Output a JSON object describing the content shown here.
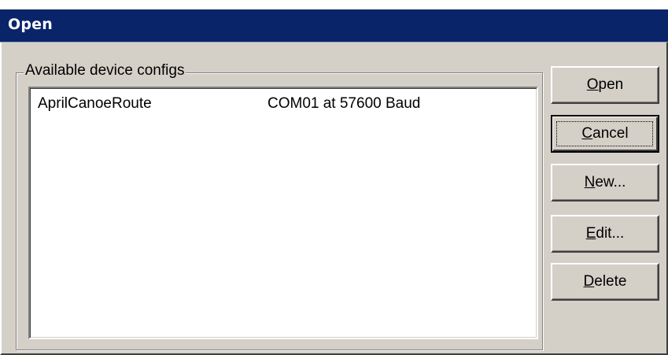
{
  "window": {
    "title": "Open"
  },
  "groupbox": {
    "label": "Available device configs"
  },
  "list": {
    "items": [
      {
        "name": "AprilCanoeRoute",
        "port": "COM01 at 57600 Baud"
      }
    ]
  },
  "buttons": {
    "open": {
      "mnemonic": "O",
      "rest": "pen"
    },
    "cancel": {
      "mnemonic": "C",
      "rest": "ancel"
    },
    "new": {
      "mnemonic": "N",
      "rest": "ew..."
    },
    "edit": {
      "mnemonic": "E",
      "rest": "dit..."
    },
    "delete": {
      "mnemonic": "D",
      "rest": "elete"
    }
  },
  "colors": {
    "titlebar": "#0a246a",
    "face": "#d4d0c8"
  }
}
